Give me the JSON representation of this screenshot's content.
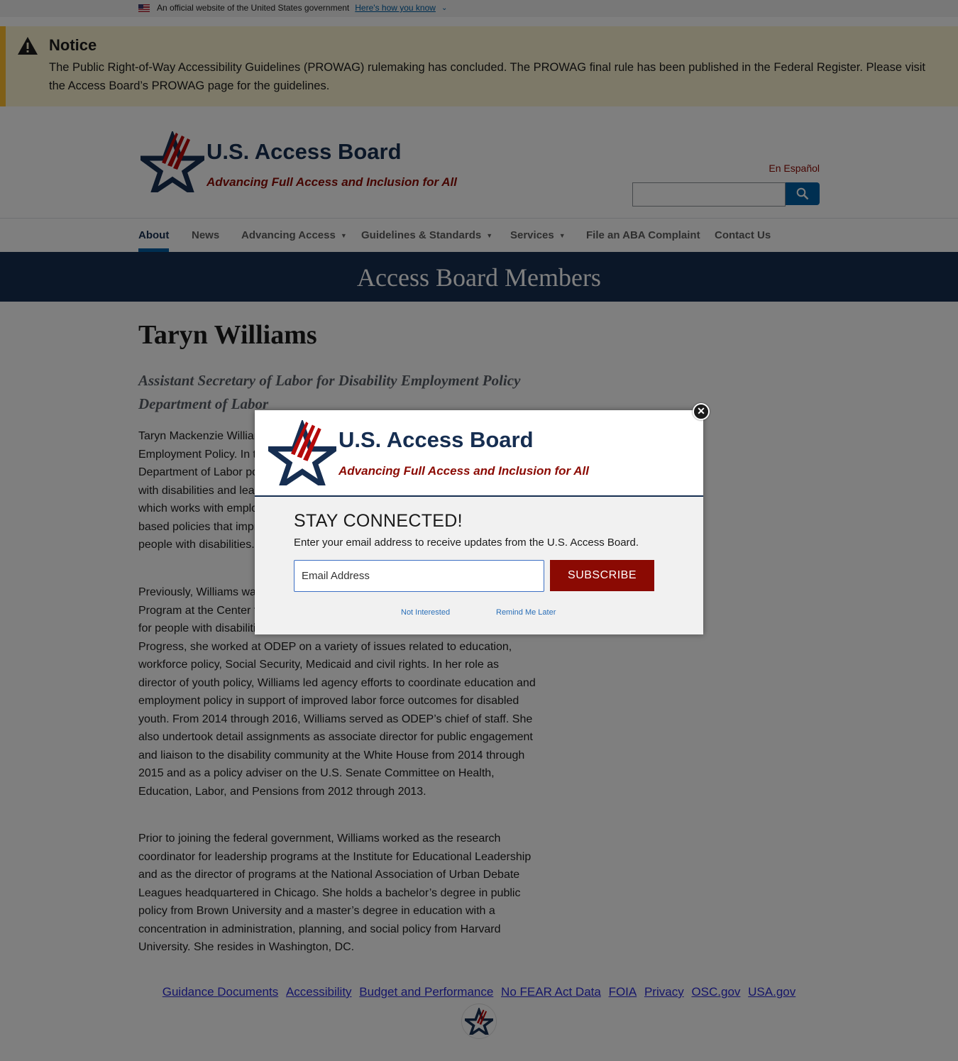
{
  "gov_banner": {
    "official_text": "An official website of the United States government",
    "how_link": "Here's how you know"
  },
  "notice": {
    "title": "Notice",
    "body": "The Public Right-of-Way Accessibility Guidelines (PROWAG) rulemaking has concluded. The PROWAG final rule has been published in the Federal Register. Please visit the Access Board’s PROWAG page for the guidelines."
  },
  "header": {
    "site_title": "U.S. Access Board",
    "tagline": "Advancing Full Access and Inclusion for All",
    "espanol_link": "En Español",
    "search_icon": "search-icon"
  },
  "nav": {
    "items": [
      {
        "label": "About",
        "dropdown": false,
        "active": true
      },
      {
        "label": "News",
        "dropdown": false
      },
      {
        "label": "Advancing Access",
        "dropdown": true
      },
      {
        "label": "Guidelines & Standards",
        "dropdown": true
      },
      {
        "label": "Services",
        "dropdown": true
      },
      {
        "label": "File an ABA Complaint",
        "dropdown": false
      },
      {
        "label": "Contact Us",
        "dropdown": false
      }
    ]
  },
  "hero": {
    "title": "Access Board Members"
  },
  "member": {
    "name": "Taryn Williams",
    "role_line1": "Assistant Secretary of Labor for Disability Employment Policy",
    "role_line2": "Department of Labor",
    "paragraph1": "Taryn Mackenzie Williams is the Assistant Secretary of Labor for Disability Employment Policy. In this role, she advises the Secretary of Labor on how Department of Labor policies and programs impact the employment of people with disabilities and leads the Office of Disability Employment Policy (ODEP), which works with employers, workers, and policymakers to promote evidence-based policies that improve employment opportunities and outcomes for people with disabilities.",
    "paragraph2": "Previously, Williams was the managing director of the Poverty to Prosperity Program at the Center for American Progress, advancing progressive policies for people with disabilities and people in poverty. Before joining American Progress, she worked at ODEP on a variety of issues related to education, workforce policy, Social Security, Medicaid and civil rights. In her role as director of youth policy, Williams led agency efforts to coordinate education and employment policy in support of improved labor force outcomes for disabled youth. From 2014 through 2016, Williams served as ODEP’s chief of staff. She also undertook detail assignments as associate director for public engagement and liaison to the disability community at the White House from 2014 through 2015 and as a policy adviser on the U.S. Senate Committee on Health, Education, Labor, and Pensions from 2012 through 2013.",
    "paragraph3": "Prior to joining the federal government, Williams worked as the research coordinator for leadership programs at the Institute for Educational Leadership and as the director of programs at the National Association of Urban Debate Leagues headquartered in Chicago. She holds a bachelor’s degree in public policy from Brown University and a master’s degree in education with a concentration in administration, planning, and social policy from Harvard University. She resides in Washington, DC."
  },
  "footer": {
    "links": [
      "Guidance Documents",
      "Accessibility",
      "Budget and Performance",
      "No FEAR Act Data",
      "FOIA",
      "Privacy",
      "OSC.gov",
      "USA.gov"
    ]
  },
  "modal": {
    "title": "U.S. Access Board",
    "tagline": "Advancing Full Access and Inclusion for All",
    "heading": "STAY CONNECTED!",
    "subtext": "Enter your email address to receive updates from the U.S. Access Board.",
    "email_placeholder": "Email Address",
    "subscribe_label": "SUBSCRIBE",
    "not_interested": "Not Interested",
    "remind_later": "Remind Me Later",
    "close_icon": "close-icon"
  },
  "colors": {
    "navy": "#162e51",
    "brand_red": "#8b0a03",
    "link_blue": "#005ea2",
    "notice_bg": "#faf3d1",
    "notice_border": "#ffbe2e"
  }
}
